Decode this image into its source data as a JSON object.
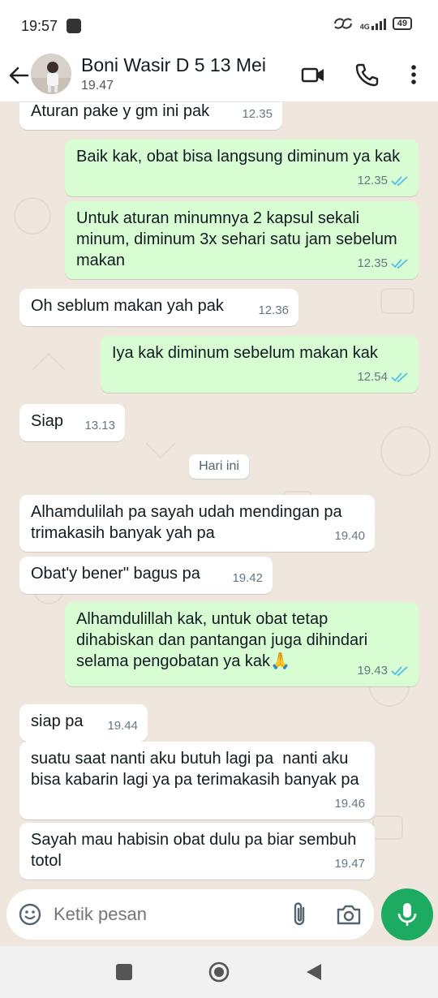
{
  "status_bar": {
    "time": "19:57",
    "network": "4G",
    "battery": "49"
  },
  "header": {
    "contact_name": "Boni Wasir D 5 13 Mei",
    "last_seen": "19.47"
  },
  "messages": [
    {
      "dir": "in",
      "text": "Aturan pake y gm ini pak",
      "time": "12.35"
    },
    {
      "dir": "out",
      "text": "Baik kak, obat bisa langsung diminum ya kak",
      "time": "12.35"
    },
    {
      "dir": "out",
      "text": "Untuk aturan minumnya 2 kapsul sekali minum, diminum 3x sehari satu jam sebelum makan",
      "time": "12.35"
    },
    {
      "dir": "in",
      "text": "Oh seblum makan yah pak",
      "time": "12.36"
    },
    {
      "dir": "out",
      "text": "Iya kak diminum sebelum makan kak",
      "time": "12.54"
    },
    {
      "dir": "in",
      "text": "Siap",
      "time": "13.13"
    },
    {
      "dir": "in",
      "text": "Alhamdulilah pa sayah udah mendingan pa trimakasih banyak yah pa",
      "time": "19.40"
    },
    {
      "dir": "in",
      "text": "Obat'y bener\" bagus pa",
      "time": "19.42"
    },
    {
      "dir": "out",
      "text": "Alhamdulillah kak, untuk obat tetap dihabiskan dan pantangan juga dihindari selama pengobatan ya kak🙏",
      "time": "19.43"
    },
    {
      "dir": "in",
      "text": "siap pa",
      "time": "19.44"
    },
    {
      "dir": "in",
      "text": "suatu saat nanti aku butuh lagi pa  nanti aku bisa kabarin lagi ya pa terimakasih banyak pa",
      "time": "19.46"
    },
    {
      "dir": "in",
      "text": "Sayah mau habisin obat dulu pa biar sembuh totol",
      "time": "19.47"
    }
  ],
  "date_divider": "Hari ini",
  "composer": {
    "placeholder": "Ketik pesan"
  },
  "colors": {
    "incoming_bubble": "#ffffff",
    "outgoing_bubble": "#d9fdd3",
    "read_ticks": "#53bdeb",
    "mic_button": "#1daa61",
    "chat_background": "#efe7dd"
  },
  "icons": [
    "back-arrow-icon",
    "video-call-icon",
    "phone-icon",
    "more-vert-icon",
    "emoji-icon",
    "attach-icon",
    "camera-icon",
    "mic-icon"
  ]
}
